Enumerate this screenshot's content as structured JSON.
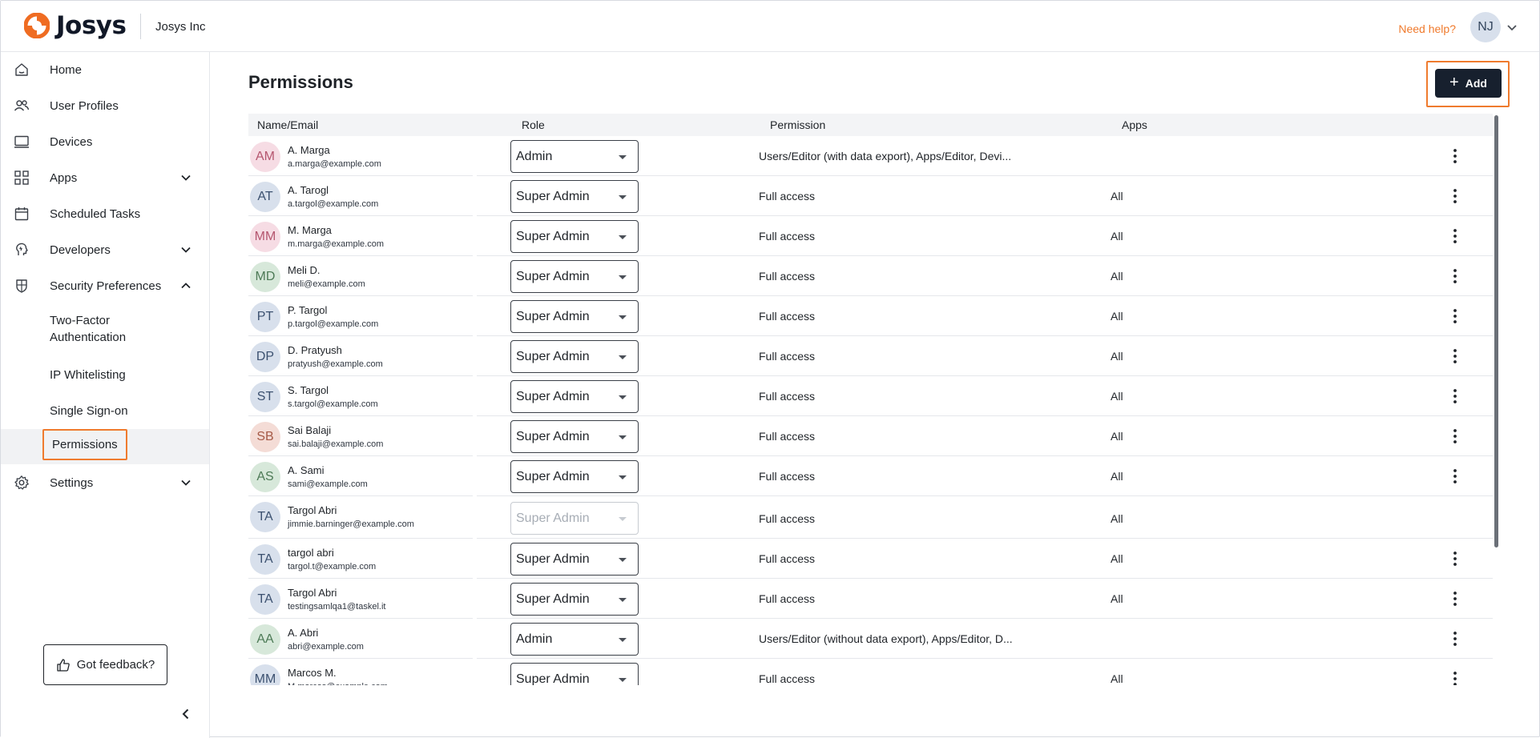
{
  "header": {
    "logo_text": "Josys",
    "org_name": "Josys Inc",
    "help_link": "Need help?",
    "user_initials": "NJ",
    "brand_color": "#ef7b2e"
  },
  "sidebar": {
    "items": [
      {
        "label": "Home",
        "icon": "home-icon"
      },
      {
        "label": "User Profiles",
        "icon": "users-icon"
      },
      {
        "label": "Devices",
        "icon": "laptop-icon"
      },
      {
        "label": "Apps",
        "icon": "apps-grid-icon"
      },
      {
        "label": "Scheduled Tasks",
        "icon": "calendar-icon"
      },
      {
        "label": "Developers",
        "icon": "developers-icon"
      },
      {
        "label": "Security Preferences",
        "icon": "shield-icon"
      },
      {
        "label": "Settings",
        "icon": "gear-icon"
      }
    ],
    "security_sub": [
      {
        "label_line1": "Two-Factor",
        "label_line2": "Authentication"
      },
      {
        "label": "IP Whitelisting"
      },
      {
        "label": "Single Sign-on"
      },
      {
        "label": "Permissions",
        "active": true
      }
    ],
    "feedback_label": "Got feedback?"
  },
  "main": {
    "title": "Permissions",
    "add_label": "Add",
    "columns": [
      "Name/Email",
      "Role",
      "Permission",
      "Apps"
    ],
    "rows": [
      {
        "initials": "AM",
        "name": "A. Marga",
        "email": "a.marga@example.com",
        "role": "Admin",
        "permission": "Users/Editor (with data export), Apps/Editor, Devi...",
        "apps": "",
        "avatar_bg": "#f6dce4",
        "avatar_fg": "#b5566f",
        "disabled": false
      },
      {
        "initials": "AT",
        "name": "A. Tarogl",
        "email": "a.targol@example.com",
        "role": "Super Admin",
        "permission": "Full access",
        "apps": "All",
        "avatar_bg": "#d8e0ec",
        "avatar_fg": "#3c5170",
        "disabled": false
      },
      {
        "initials": "MM",
        "name": "M. Marga",
        "email": "m.marga@example.com",
        "role": "Super Admin",
        "permission": "Full access",
        "apps": "All",
        "avatar_bg": "#f6dce4",
        "avatar_fg": "#b5566f",
        "disabled": false
      },
      {
        "initials": "MD",
        "name": "Meli D.",
        "email": "meli@example.com",
        "role": "Super Admin",
        "permission": "Full access",
        "apps": "All",
        "avatar_bg": "#d7e8da",
        "avatar_fg": "#4d7a56",
        "disabled": false
      },
      {
        "initials": "PT",
        "name": "P. Targol",
        "email": "p.targol@example.com",
        "role": "Super Admin",
        "permission": "Full access",
        "apps": "All",
        "avatar_bg": "#d8e0ec",
        "avatar_fg": "#3c5170",
        "disabled": false
      },
      {
        "initials": "DP",
        "name": "D. Pratyush",
        "email": "pratyush@example.com",
        "role": "Super Admin",
        "permission": "Full access",
        "apps": "All",
        "avatar_bg": "#d8e0ec",
        "avatar_fg": "#3c5170",
        "disabled": false
      },
      {
        "initials": "ST",
        "name": "S. Targol",
        "email": "s.targol@example.com",
        "role": "Super Admin",
        "permission": "Full access",
        "apps": "All",
        "avatar_bg": "#d8e0ec",
        "avatar_fg": "#3c5170",
        "disabled": false
      },
      {
        "initials": "SB",
        "name": "Sai Balaji",
        "email": "sai.balaji@example.com",
        "role": "Super Admin",
        "permission": "Full access",
        "apps": "All",
        "avatar_bg": "#f4dcd6",
        "avatar_fg": "#a65a47",
        "disabled": false
      },
      {
        "initials": "AS",
        "name": "A. Sami",
        "email": "sami@example.com",
        "role": "Super Admin",
        "permission": "Full access",
        "apps": "All",
        "avatar_bg": "#d7e8da",
        "avatar_fg": "#4d7a56",
        "disabled": false
      },
      {
        "initials": "TA",
        "name": "Targol Abri",
        "email": "jimmie.barninger@example.com",
        "role": "Super Admin",
        "permission": "Full access",
        "apps": "All",
        "avatar_bg": "#d8e0ec",
        "avatar_fg": "#3c5170",
        "disabled": true
      },
      {
        "initials": "TA",
        "name": "targol abri",
        "email": "targol.t@example.com",
        "role": "Super Admin",
        "permission": "Full access",
        "apps": "All",
        "avatar_bg": "#d8e0ec",
        "avatar_fg": "#3c5170",
        "disabled": false
      },
      {
        "initials": "TA",
        "name": "Targol Abri",
        "email": "testingsamlqa1@taskel.it",
        "role": "Super Admin",
        "permission": "Full access",
        "apps": "All",
        "avatar_bg": "#d8e0ec",
        "avatar_fg": "#3c5170",
        "disabled": false
      },
      {
        "initials": "AA",
        "name": "A. Abri",
        "email": "abri@example.com",
        "role": "Admin",
        "permission": "Users/Editor (without data export), Apps/Editor, D...",
        "apps": "",
        "avatar_bg": "#d7e8da",
        "avatar_fg": "#4d7a56",
        "disabled": false
      },
      {
        "initials": "MM",
        "name": "Marcos M.",
        "email": "M.marcos@example.com",
        "role": "Super Admin",
        "permission": "Full access",
        "apps": "All",
        "avatar_bg": "#d8e0ec",
        "avatar_fg": "#3c5170",
        "disabled": false
      }
    ]
  }
}
